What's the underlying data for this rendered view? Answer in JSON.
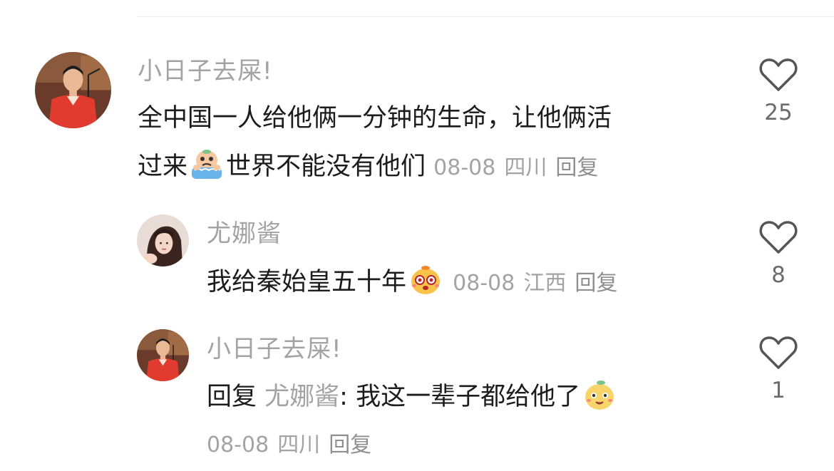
{
  "comments": [
    {
      "username": "小日子去屎!",
      "text_line1": "全中国一人给他俩一分钟的生命，让他俩活",
      "text_line2_pre": "过来",
      "text_line2_post": "世界不能没有他们",
      "date": "08-08",
      "location": "四川",
      "reply_label": "回复",
      "likes": "25",
      "emoji": "crying-emoji"
    },
    {
      "username": "尤娜酱",
      "text": "我给秦始皇五十年",
      "date": "08-08",
      "location": "江西",
      "reply_label": "回复",
      "likes": "8",
      "emoji": "dazzled-emoji"
    },
    {
      "username": "小日子去屎!",
      "reply_prefix": "回复",
      "mention": "尤娜酱",
      "text": ": 我这一辈子都给他了",
      "date": "08-08",
      "location": "四川",
      "reply_label": "回复",
      "likes": "1",
      "emoji": "happy-emoji"
    }
  ]
}
